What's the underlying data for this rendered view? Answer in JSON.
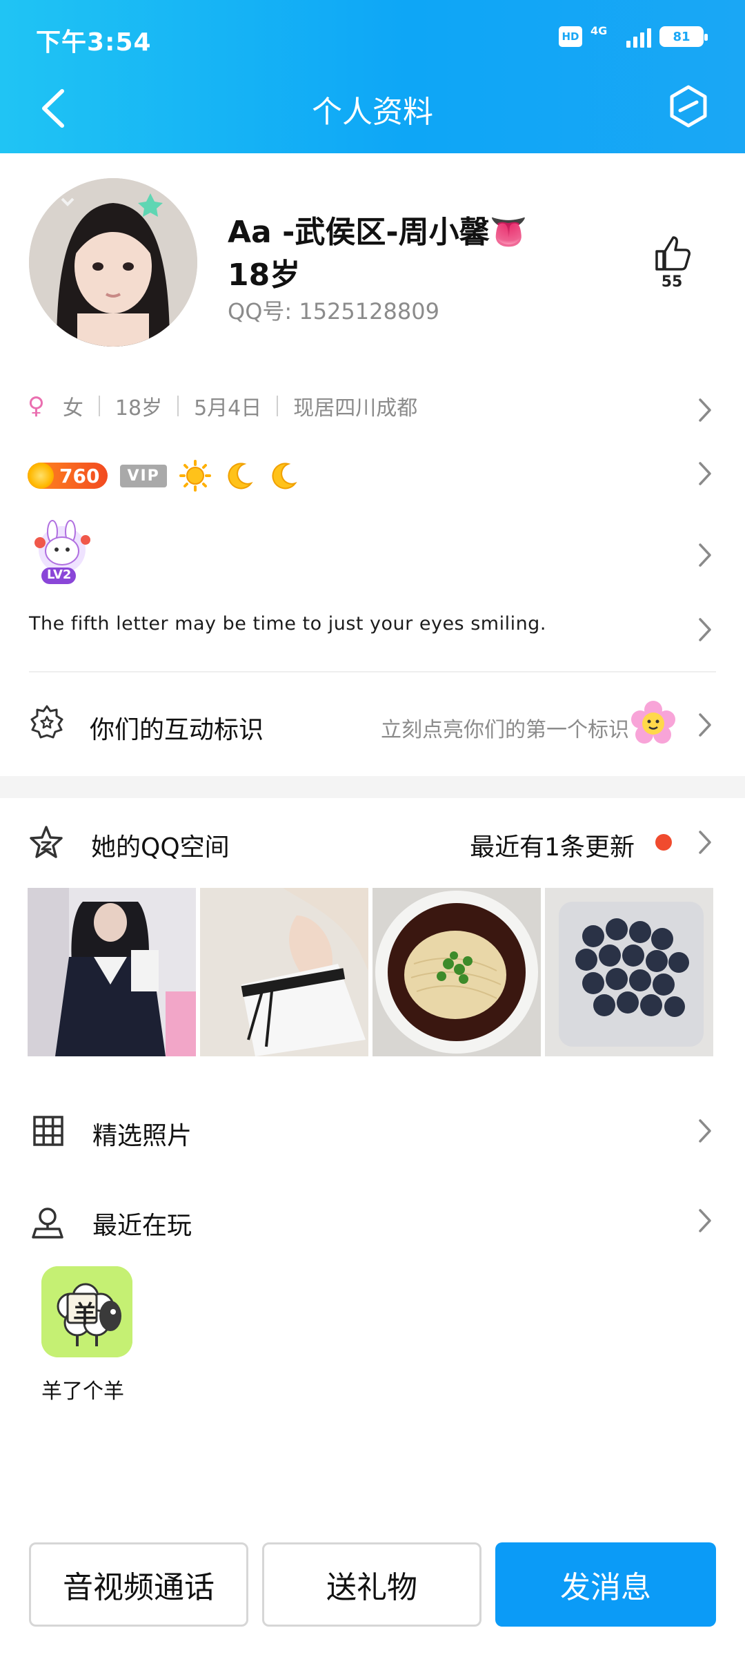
{
  "status_bar": {
    "time": "下午3:54",
    "hd": "HD",
    "network": "4G",
    "battery": "81"
  },
  "header": {
    "title": "个人资料"
  },
  "profile": {
    "name": "Aa  -武侯区-周小馨👅",
    "age": "18岁",
    "qq_number": "QQ号: 1525128809",
    "likes": "55"
  },
  "info": {
    "gender_symbol": "♀",
    "gender": "女",
    "age": "18岁",
    "birthday": "5月4日",
    "location": "现居四川成都"
  },
  "badges": {
    "coin_value": "760",
    "vip": "VIP"
  },
  "level_badge": "LV2",
  "signature": "The fifth letter may be time to just your eyes smiling.",
  "interaction": {
    "label": "你们的互动标识",
    "hint": "立刻点亮你们的第一个标识"
  },
  "qzone": {
    "label": "她的QQ空间",
    "update": "最近有1条更新"
  },
  "menu": {
    "photos_label": "精选照片",
    "recent_label": "最近在玩"
  },
  "recent_game": {
    "name": "羊了个羊",
    "icon_char": "羊"
  },
  "buttons": {
    "call": "音视频通话",
    "gift": "送礼物",
    "message": "发消息"
  },
  "colors": {
    "header_start": "#20c4f4",
    "header_end": "#0ea6f6",
    "primary": "#0b9bf7",
    "update_dot": "#f04b2e"
  }
}
